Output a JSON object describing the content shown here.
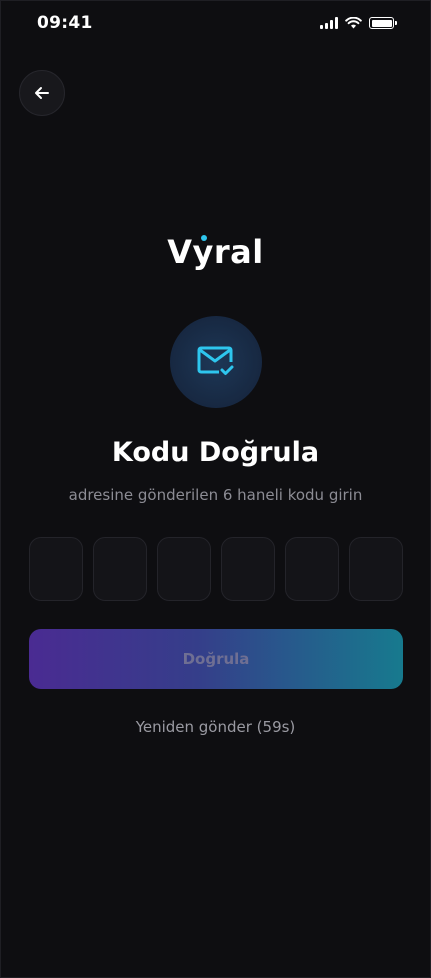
{
  "status_bar": {
    "time": "09:41"
  },
  "logo": {
    "text": "Vyral"
  },
  "title": "Kodu Doğrula",
  "subtitle": "adresine gönderilen 6 haneli kodu girin",
  "otp": {
    "digits": [
      "",
      "",
      "",
      "",
      "",
      ""
    ]
  },
  "verify_button": {
    "label": "Doğrula"
  },
  "resend": {
    "label": "Yeniden gönder (59s)"
  },
  "colors": {
    "background": "#0e0e11",
    "accent_cyan": "#2ec6ee",
    "gradient_start": "#4a2b92",
    "gradient_end": "#177a8e"
  },
  "icons": [
    "back-arrow-icon",
    "mail-check-icon",
    "signal-icon",
    "wifi-icon",
    "battery-icon"
  ]
}
